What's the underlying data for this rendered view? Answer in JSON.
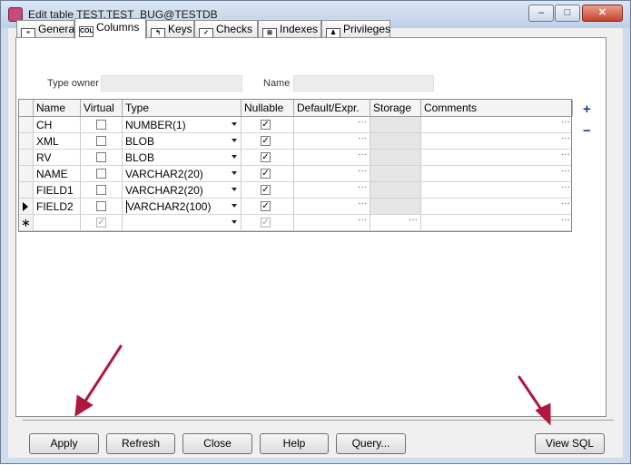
{
  "window": {
    "title": "Edit table TEST.TEST_BUG@TESTDB",
    "controls": {
      "minimize": "–",
      "maximize": "□",
      "close": "✕"
    }
  },
  "tabs": [
    {
      "label": "General",
      "icon": "general-icon",
      "icon_text": "≡"
    },
    {
      "label": "Columns",
      "icon": "columns-icon",
      "icon_text": "COL"
    },
    {
      "label": "Keys",
      "icon": "key-icon",
      "icon_text": "↰"
    },
    {
      "label": "Checks",
      "icon": "check-icon",
      "icon_text": "✓"
    },
    {
      "label": "Indexes",
      "icon": "index-icon",
      "icon_text": "⊞"
    },
    {
      "label": "Privileges",
      "icon": "users-icon",
      "icon_text": "♟"
    }
  ],
  "fields": {
    "type_owner_label": "Type owner",
    "type_owner_value": "",
    "name_label": "Name",
    "name_value": ""
  },
  "side_buttons": {
    "add": "+",
    "remove": "−"
  },
  "grid": {
    "headers": [
      "Name",
      "Virtual",
      "Type",
      "Nullable",
      "Default/Expr.",
      "Storage",
      "Comments"
    ],
    "ellipsis": "···",
    "new_row_marker": "∗",
    "rows": [
      {
        "name": "CH",
        "virtual": false,
        "type": "NUMBER(1)",
        "nullable": true
      },
      {
        "name": "XML",
        "virtual": false,
        "type": "BLOB",
        "nullable": true
      },
      {
        "name": "RV",
        "virtual": false,
        "type": "BLOB",
        "nullable": true
      },
      {
        "name": "NAME",
        "virtual": false,
        "type": "VARCHAR2(20)",
        "nullable": true
      },
      {
        "name": "FIELD1",
        "virtual": false,
        "type": "VARCHAR2(20)",
        "nullable": true
      },
      {
        "name": "FIELD2",
        "virtual": false,
        "type": "VARCHAR2(100)",
        "nullable": true,
        "current": true
      }
    ]
  },
  "buttons": {
    "apply": "Apply",
    "refresh": "Refresh",
    "close": "Close",
    "help": "Help",
    "query": "Query...",
    "view_sql": "View SQL"
  },
  "annotation_color": "#b0173f"
}
